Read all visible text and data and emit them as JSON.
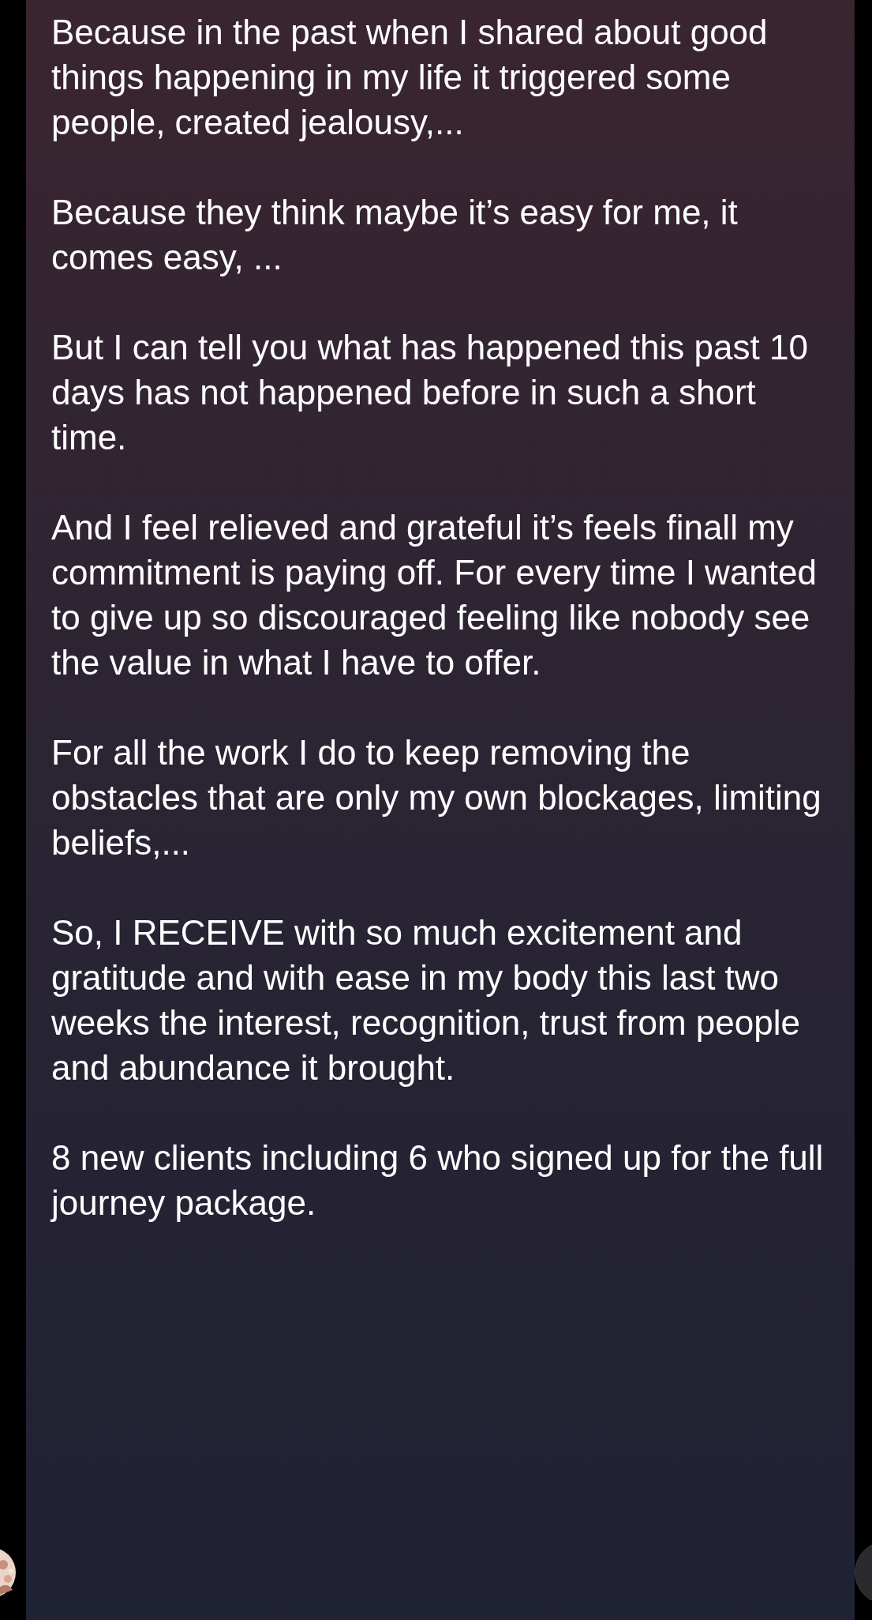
{
  "message": {
    "paragraphs": [
      "Because in the past when I shared about good things happening in my life it triggered some people, created jealousy,...",
      "Because they think maybe it’s easy for me, it comes easy, ...",
      "But I can tell you what has happened this past 10 days has not happened before in such a short time.",
      "And I feel relieved and grateful it’s feels finall my commitment is paying off. For every time I wanted to give up so discouraged feeling like nobody see the value in what I have to offer.",
      "For all the work I do to keep removing the obstacles that are only my own blockages, limiting beliefs,...",
      "So, I RECEIVE with so much excitement and gratitude and with ease in my body this last two weeks the interest, recognition, trust from people and abundance it brought.",
      "8 new clients including 6 who signed up for the full journey package."
    ]
  }
}
